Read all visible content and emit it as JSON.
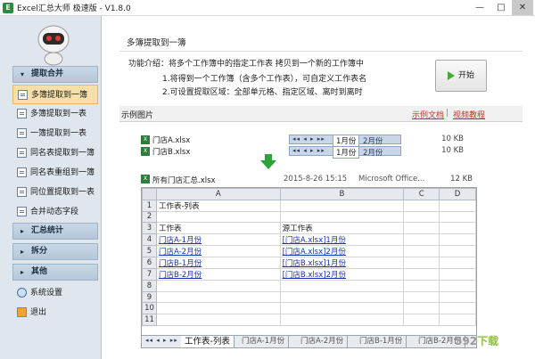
{
  "window": {
    "title": "Excel汇总大师 极速版 - V1.8.0",
    "app_icon": "E",
    "minimize": "—",
    "maximize": "□",
    "close": "✕"
  },
  "sidebar": {
    "merge_head": "提取合并",
    "merge_items": [
      {
        "label": "多簿提取到一簿"
      },
      {
        "label": "多簿提取到一表"
      },
      {
        "label": "一簿提取到一表"
      },
      {
        "label": "同名表提取到一簿"
      },
      {
        "label": "同名表重组到一簿"
      },
      {
        "label": "同位置提取到一表"
      },
      {
        "label": "合并动态字段"
      }
    ],
    "stats_head": "汇总统计",
    "split_head": "拆分",
    "other_head": "其他",
    "settings_label": "系统设置",
    "exit_label": "退出"
  },
  "content": {
    "section_title": "多簿提取到一簿",
    "desc_line1": "功能介绍：将多个工作簿中的指定工作表 拷贝到一个新的工作簿中",
    "desc_line2": "1.将得到一个工作簿（含多个工作表），可自定义工作表名",
    "desc_line3": "2.可设置提取区域：全部单元格、指定区域、离时到离时",
    "start_label": "开始",
    "example_label": "示例图片",
    "example_doc_link": "示例文档",
    "video_link": "视频教程",
    "link_sep": "|"
  },
  "example": {
    "files": [
      {
        "name": "门店A.xlsx",
        "tab1": "1月份",
        "tab2": "2月份",
        "size": "10 KB"
      },
      {
        "name": "门店B.xlsx",
        "tab1": "1月份",
        "tab2": "2月份",
        "size": "10 KB"
      }
    ],
    "sheet_nav": "◂◂ ◂ ▸ ▸▸",
    "output": {
      "name": "所有门店汇总.xlsx",
      "date": "2015-8-26 15:15",
      "type": "Microsoft Office...",
      "size": "12 KB"
    },
    "columns": [
      "A",
      "B",
      "C",
      "D"
    ],
    "rows": [
      {
        "num": "1",
        "a": "工作表-列表",
        "b": "",
        "a_link": false,
        "b_link": false
      },
      {
        "num": "2",
        "a": "",
        "b": "",
        "a_link": false,
        "b_link": false
      },
      {
        "num": "3",
        "a": "工作表",
        "b": "源工作表",
        "a_link": false,
        "b_link": false
      },
      {
        "num": "4",
        "a": "门店A-1月份",
        "b": "[门店A.xlsx]1月份",
        "a_link": true,
        "b_link": true
      },
      {
        "num": "5",
        "a": "门店A-2月份",
        "b": "[门店A.xlsx]2月份",
        "a_link": true,
        "b_link": true
      },
      {
        "num": "6",
        "a": "门店B-1月份",
        "b": "[门店B.xlsx]1月份",
        "a_link": true,
        "b_link": true
      },
      {
        "num": "7",
        "a": "门店B-2月份",
        "b": "[门店B.xlsx]2月份",
        "a_link": true,
        "b_link": true
      },
      {
        "num": "8",
        "a": "",
        "b": "",
        "a_link": false,
        "b_link": false
      },
      {
        "num": "9",
        "a": "",
        "b": "",
        "a_link": false,
        "b_link": false
      },
      {
        "num": "10",
        "a": "",
        "b": "",
        "a_link": false,
        "b_link": false
      },
      {
        "num": "11",
        "a": "",
        "b": "",
        "a_link": false,
        "b_link": false
      }
    ],
    "sheet_tabs": [
      "工作表-列表",
      "门店A-1月份",
      "门店A-2月份",
      "门店B-1月份",
      "门店B-2月份"
    ]
  },
  "watermark": {
    "num": "592",
    "text": "下载"
  }
}
